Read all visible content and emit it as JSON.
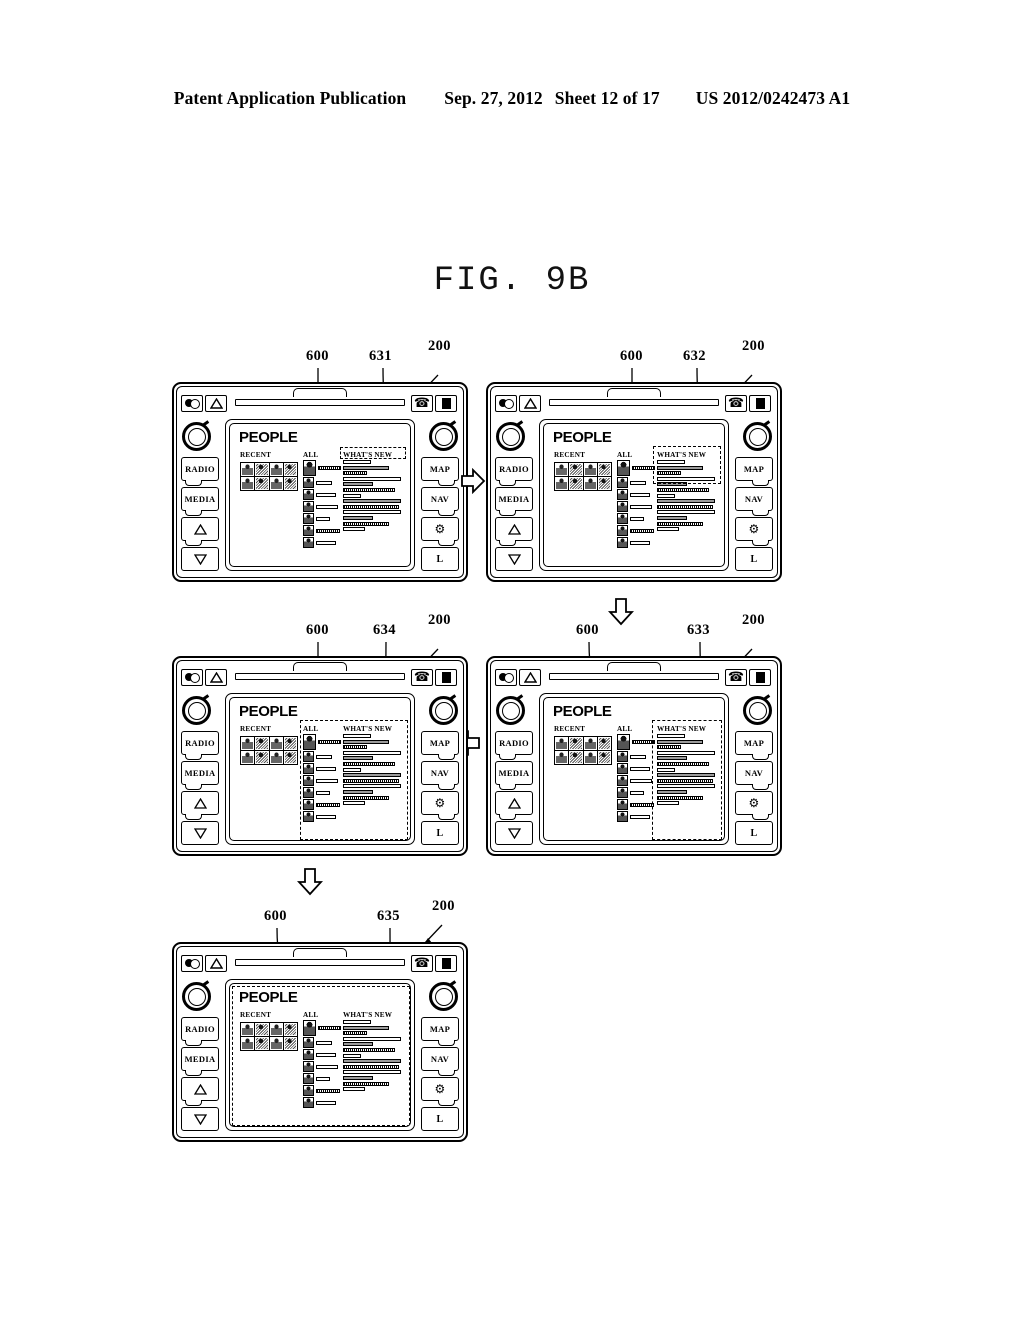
{
  "header": {
    "publication": "Patent Application Publication",
    "date": "Sep. 27, 2012",
    "sheet": "Sheet 12 of 17",
    "number": "US 2012/0242473 A1"
  },
  "figure": {
    "title": "FIG.  9B"
  },
  "device": {
    "reference": "200",
    "screen_reference": "600",
    "top_bar": {
      "light_icon": "headlight-icon",
      "eject_icon": "eject-triangle-icon",
      "cd_slot": "cd-slot",
      "phone_icon": "phone-icon",
      "stop_icon": "stop-square-icon"
    },
    "left_buttons": [
      {
        "label": "RADIO",
        "icon": ""
      },
      {
        "label": "MEDIA",
        "icon": ""
      },
      {
        "label": "",
        "icon": "triangle-up-icon"
      },
      {
        "label": "",
        "icon": "triangle-down-icon"
      }
    ],
    "right_buttons": [
      {
        "label": "MAP",
        "icon": ""
      },
      {
        "label": "NAV",
        "icon": ""
      },
      {
        "label": "",
        "icon": "gear-icon"
      },
      {
        "label": "L",
        "icon": "power-icon"
      }
    ],
    "knob_left": "volume-knob",
    "knob_right": "tune-knob"
  },
  "screen": {
    "title": "PEOPLE",
    "columns": {
      "recent": "RECENT",
      "all": "ALL",
      "whats_new": "WHAT'S NEW"
    },
    "recent_thumbnail_count": 8,
    "all_rows": 7,
    "feed_rows": 13
  },
  "panels": [
    {
      "id": "panel-631",
      "highlight_reference": "631",
      "screen_reference": "600",
      "device_reference": "200",
      "highlight_target": "whats-new-header"
    },
    {
      "id": "panel-632",
      "highlight_reference": "632",
      "screen_reference": "600",
      "device_reference": "200",
      "highlight_target": "whats-new-header-expanded"
    },
    {
      "id": "panel-633",
      "highlight_reference": "633",
      "screen_reference": "600",
      "device_reference": "200",
      "highlight_target": "whats-new-column"
    },
    {
      "id": "panel-634",
      "highlight_reference": "634",
      "screen_reference": "600",
      "device_reference": "200",
      "highlight_target": "all-and-whats-new-columns"
    },
    {
      "id": "panel-635",
      "highlight_reference": "635",
      "screen_reference": "600",
      "device_reference": "200",
      "highlight_target": "entire-screen"
    }
  ],
  "flow_arrows": [
    {
      "id": "arrow-1-to-2",
      "direction": "right"
    },
    {
      "id": "arrow-2-to-3",
      "direction": "down"
    },
    {
      "id": "arrow-3-to-4",
      "direction": "left"
    },
    {
      "id": "arrow-4-to-5",
      "direction": "down"
    }
  ],
  "feed_bar_widths": [
    28,
    46,
    24,
    58,
    30,
    52,
    18,
    58,
    56,
    58,
    30,
    46,
    22,
    56,
    40
  ],
  "all_bar_widths": [
    24,
    16,
    20,
    22,
    14,
    24,
    20
  ]
}
